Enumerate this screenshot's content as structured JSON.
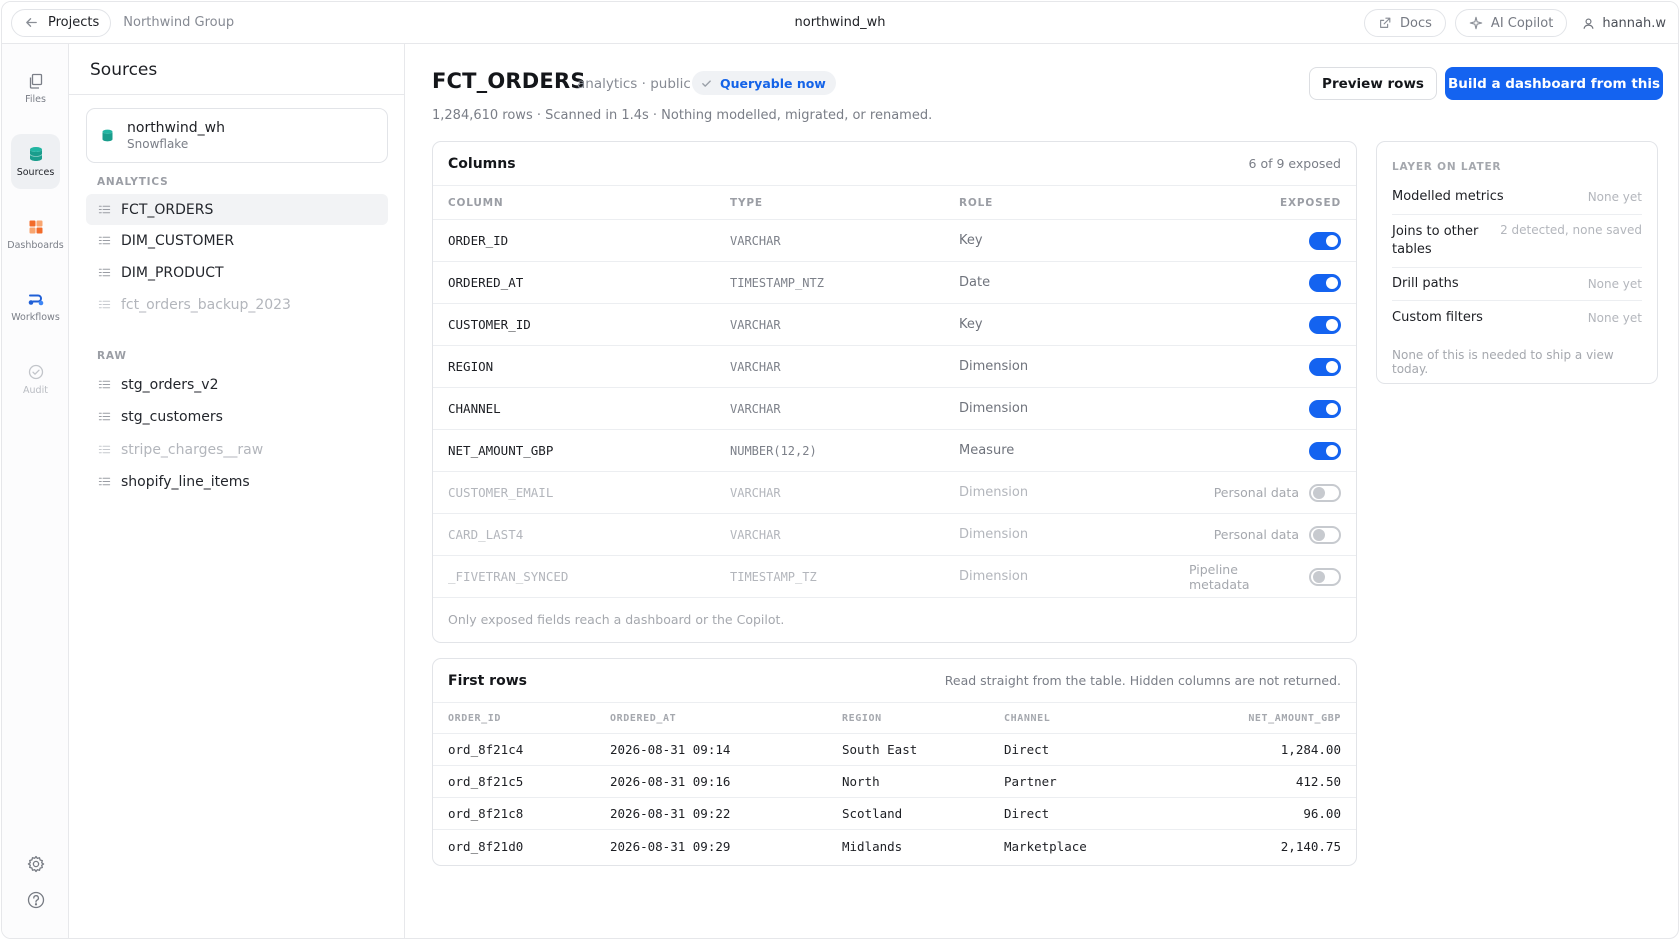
{
  "topbar": {
    "back_label": "Projects",
    "breadcrumb": "Northwind Group",
    "title": "northwind_wh",
    "docs_label": "Docs",
    "copilot_label": "AI Copilot",
    "user_name": "hannah.w"
  },
  "rail": {
    "files": "Files",
    "sources": "Sources",
    "dashboards": "Dashboards",
    "workflows": "Workflows",
    "audit": "Audit"
  },
  "sources_panel": {
    "title": "Sources",
    "connection": {
      "name": "northwind_wh",
      "type": "Snowflake"
    },
    "groups": [
      {
        "label": "ANALYTICS",
        "items": [
          {
            "name": "FCT_ORDERS",
            "state": "active"
          },
          {
            "name": "DIM_CUSTOMER",
            "state": "normal"
          },
          {
            "name": "DIM_PRODUCT",
            "state": "normal"
          },
          {
            "name": "fct_orders_backup_2023",
            "state": "muted"
          }
        ]
      },
      {
        "label": "RAW",
        "items": [
          {
            "name": "stg_orders_v2",
            "state": "normal"
          },
          {
            "name": "stg_customers",
            "state": "normal"
          },
          {
            "name": "stripe_charges__raw",
            "state": "muted"
          },
          {
            "name": "shopify_line_items",
            "state": "normal"
          }
        ]
      }
    ]
  },
  "header": {
    "table_name": "FCT_ORDERS",
    "schema": "analytics · public",
    "status_badge": "Queryable now",
    "summary": "1,284,610 rows · Scanned in 1.4s · Nothing modelled, migrated, or renamed.",
    "preview_label": "Preview rows",
    "build_label": "Build a dashboard from this"
  },
  "columns_card": {
    "title": "Columns",
    "exposed_count": "6 of 9 exposed",
    "headers": {
      "column": "COLUMN",
      "type": "TYPE",
      "role": "ROLE",
      "exposed": "EXPOSED"
    },
    "rows": [
      {
        "name": "ORDER_ID",
        "type": "VARCHAR",
        "role": "Key",
        "exposed": true,
        "note": ""
      },
      {
        "name": "ORDERED_AT",
        "type": "TIMESTAMP_NTZ",
        "role": "Date",
        "exposed": true,
        "note": ""
      },
      {
        "name": "CUSTOMER_ID",
        "type": "VARCHAR",
        "role": "Key",
        "exposed": true,
        "note": ""
      },
      {
        "name": "REGION",
        "type": "VARCHAR",
        "role": "Dimension",
        "exposed": true,
        "note": ""
      },
      {
        "name": "CHANNEL",
        "type": "VARCHAR",
        "role": "Dimension",
        "exposed": true,
        "note": ""
      },
      {
        "name": "NET_AMOUNT_GBP",
        "type": "NUMBER(12,2)",
        "role": "Measure",
        "exposed": true,
        "note": ""
      },
      {
        "name": "CUSTOMER_EMAIL",
        "type": "VARCHAR",
        "role": "Dimension",
        "exposed": false,
        "note": "Personal data"
      },
      {
        "name": "CARD_LAST4",
        "type": "VARCHAR",
        "role": "Dimension",
        "exposed": false,
        "note": "Personal data"
      },
      {
        "name": "_FIVETRAN_SYNCED",
        "type": "TIMESTAMP_TZ",
        "role": "Dimension",
        "exposed": false,
        "note": "Pipeline metadata"
      }
    ],
    "footer": "Only exposed fields reach a dashboard or the Copilot."
  },
  "later_card": {
    "label": "LAYER ON LATER",
    "items": [
      {
        "name": "Modelled metrics",
        "value": "None yet"
      },
      {
        "name": "Joins to other tables",
        "value": "2 detected, none saved"
      },
      {
        "name": "Drill paths",
        "value": "None yet"
      },
      {
        "name": "Custom filters",
        "value": "None yet"
      }
    ],
    "note": "None of this is needed to ship a view today."
  },
  "rows_card": {
    "title": "First rows",
    "meta": "Read straight from the table. Hidden columns are not returned.",
    "headers": [
      "ORDER_ID",
      "ORDERED_AT",
      "REGION",
      "CHANNEL",
      "NET_AMOUNT_GBP"
    ],
    "rows": [
      [
        "ord_8f21c4",
        "2026-08-31 09:14",
        "South East",
        "Direct",
        "1,284.00"
      ],
      [
        "ord_8f21c5",
        "2026-08-31 09:16",
        "North",
        "Partner",
        "412.50"
      ],
      [
        "ord_8f21c8",
        "2026-08-31 09:22",
        "Scotland",
        "Direct",
        "96.00"
      ],
      [
        "ord_8f21d0",
        "2026-08-31 09:29",
        "Midlands",
        "Marketplace",
        "2,140.75"
      ]
    ]
  },
  "colors": {
    "accent": "#1463f0",
    "database_icon": "#22b5a2",
    "dashboards_icon": "#f26b2a",
    "workflows_icon": "#1f5fd6"
  }
}
